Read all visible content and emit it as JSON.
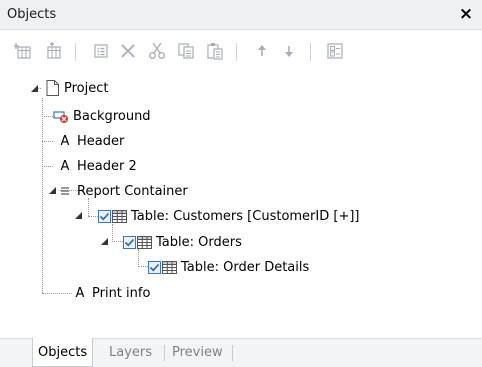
{
  "panel": {
    "title": "Objects",
    "close_glyph": "×"
  },
  "toolbar": {
    "buttons": [
      {
        "icon": "insert-object-icon"
      },
      {
        "icon": "append-object-icon"
      },
      {
        "icon": "properties-icon"
      },
      {
        "icon": "delete-icon"
      },
      {
        "icon": "cut-icon"
      },
      {
        "icon": "copy-icon"
      },
      {
        "icon": "paste-icon"
      },
      {
        "icon": "move-up-icon"
      },
      {
        "icon": "move-down-icon"
      },
      {
        "icon": "rename-icon"
      }
    ]
  },
  "tree": {
    "project": "Project",
    "background": "Background",
    "header": "Header",
    "header2": "Header 2",
    "report_container": "Report Container",
    "table_customers": "Table: Customers [CustomerID [+]]",
    "table_orders": "Table: Orders",
    "table_order_details": "Table: Order Details",
    "print_info": "Print info"
  },
  "tabs": [
    {
      "label": "Objects",
      "active": true
    },
    {
      "label": "Layers",
      "active": false
    },
    {
      "label": "Preview",
      "active": false
    }
  ],
  "colors": {
    "accent_blue": "#3c76c5",
    "icon_grey": "#a8adb5",
    "background_icon_red": "#d9362b"
  }
}
